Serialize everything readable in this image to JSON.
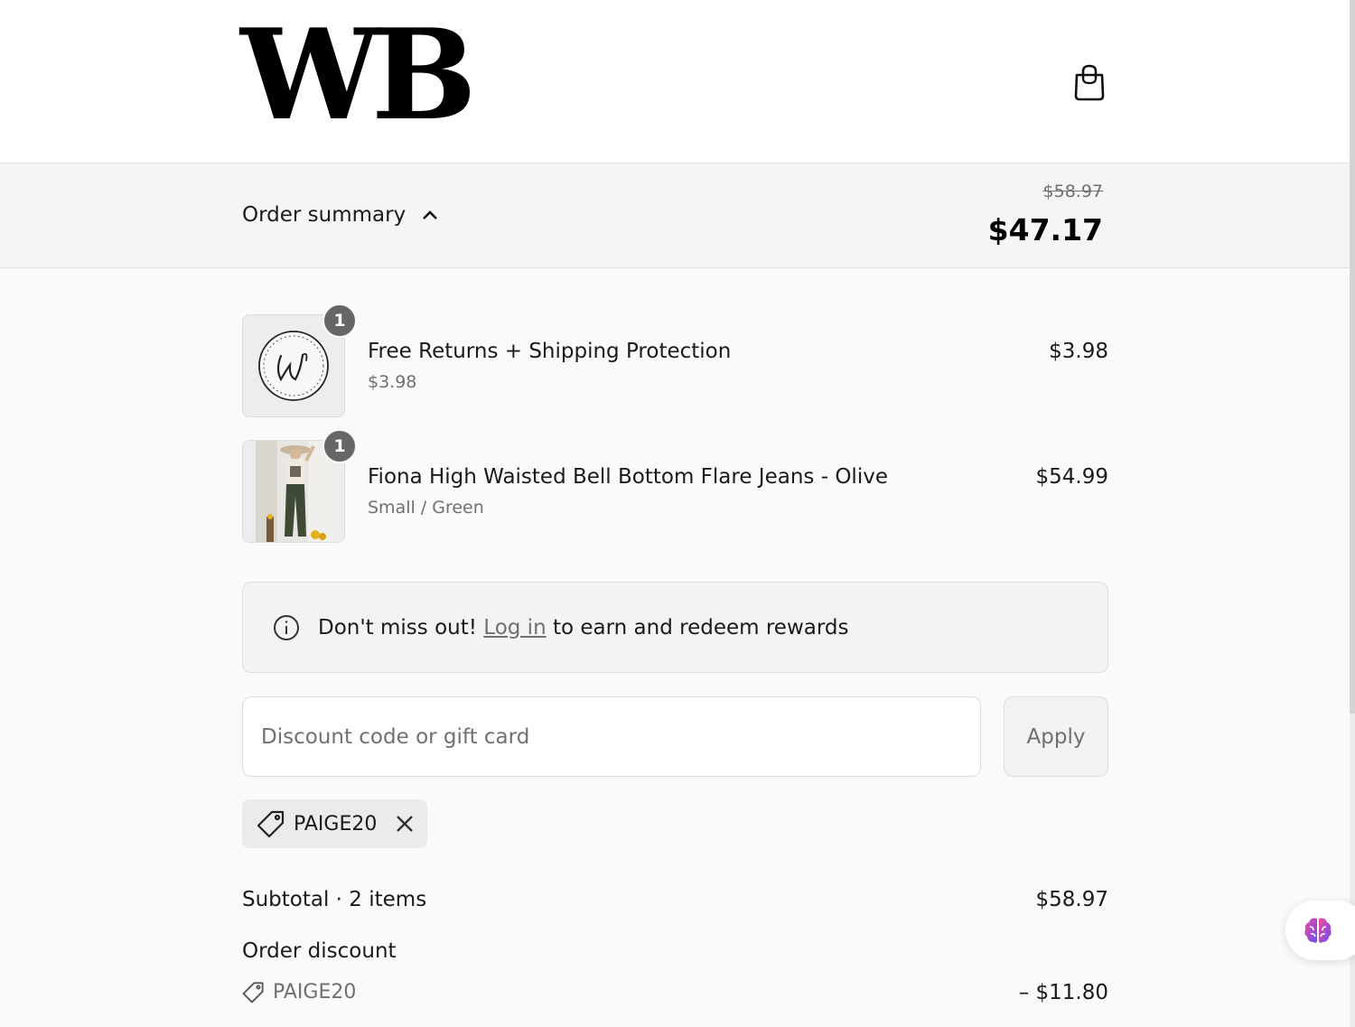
{
  "header": {
    "logo_text": "WB",
    "cart_icon": "shopping-bag-icon"
  },
  "order_summary": {
    "toggle_label": "Order summary",
    "toggle_icon": "chevron-up-icon",
    "original_total": "$58.97",
    "total": "$47.17"
  },
  "line_items": [
    {
      "quantity": "1",
      "title": "Free Returns + Shipping Protection",
      "subtitle": "$3.98",
      "price": "$3.98",
      "thumbnail": "seal-logo"
    },
    {
      "quantity": "1",
      "title": "Fiona High Waisted Bell Bottom Flare Jeans - Olive",
      "subtitle": "Small / Green",
      "price": "$54.99",
      "thumbnail": "product-photo"
    }
  ],
  "rewards": {
    "icon": "info-icon",
    "text_before": "Don't miss out! ",
    "link_label": "Log in",
    "text_after": " to earn and redeem rewards"
  },
  "discount": {
    "placeholder": "Discount code or gift card",
    "value": "",
    "apply_label": "Apply",
    "applied_code": "PAIGE20"
  },
  "totals": {
    "subtotal_label": "Subtotal · 2 items",
    "subtotal_value": "$58.97",
    "discount_label": "Order discount",
    "discount_code": "PAIGE20",
    "discount_value": "– $11.80"
  },
  "colors": {
    "text": "#1a1a1a",
    "muted": "#707070",
    "badge": "#666666",
    "panel": "#f5f5f5"
  }
}
